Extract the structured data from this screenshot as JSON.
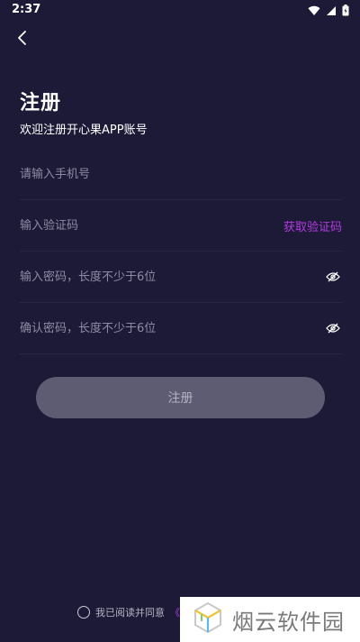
{
  "status_bar": {
    "time": "2:37",
    "icons": [
      "wifi-icon",
      "signal-icon",
      "battery-icon"
    ]
  },
  "header": {
    "back_icon": "chevron-left-icon"
  },
  "title": "注册",
  "subtitle": "欢迎注册开心果APP账号",
  "fields": {
    "phone": {
      "placeholder": "请输入手机号",
      "value": ""
    },
    "code": {
      "placeholder": "输入验证码",
      "value": "",
      "action_label": "获取验证码"
    },
    "password": {
      "placeholder": "输入密码，长度不少于6位",
      "value": "",
      "toggle_icon": "eye-off-icon"
    },
    "confirm_password": {
      "placeholder": "确认密码，长度不少于6位",
      "value": "",
      "toggle_icon": "eye-off-icon"
    }
  },
  "submit_label": "注册",
  "agreement": {
    "text": "我已阅读并同意",
    "link_text": "《用",
    "checked": false
  },
  "watermark": {
    "text": "烟云软件园",
    "icon": "cube-logo-icon"
  },
  "colors": {
    "background": "#1c1a36",
    "accent": "#b23ce0",
    "button_bg": "#5d5c72",
    "placeholder": "#8e8ca4"
  }
}
